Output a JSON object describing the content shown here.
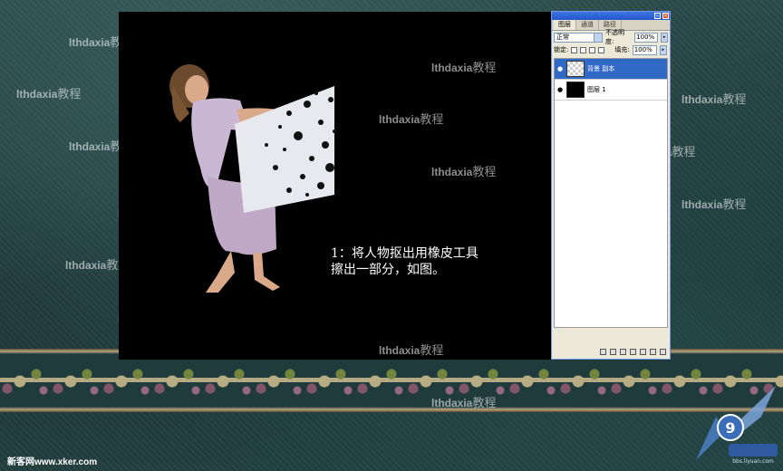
{
  "watermarks": [
    {
      "text": "lthdaxia",
      "cn": "教程"
    },
    {
      "text": "lthdaxia",
      "cn": "教程"
    },
    {
      "text": "lthdaxia",
      "cn": "教程"
    },
    {
      "text": "lthdaxia",
      "cn": "教程"
    },
    {
      "text": "lthdaxia",
      "cn": "教程"
    },
    {
      "text": "lthdaxia",
      "cn": "教程"
    },
    {
      "text": "lthdaxia",
      "cn": "教程"
    },
    {
      "text": "lthdaxia",
      "cn": "教程"
    },
    {
      "text": "lthdaxia",
      "cn": "教程"
    },
    {
      "text": "lthdaxia",
      "cn": "教程"
    },
    {
      "text": "lthdaxia",
      "cn": "教程"
    },
    {
      "text": "lthdaxia",
      "cn": "教程"
    },
    {
      "text": "lthdaxia",
      "cn": "教程"
    },
    {
      "text": "lthdaxia",
      "cn": "教程"
    }
  ],
  "caption": {
    "line1": "1：将人物抠出用橡皮工具",
    "line2": "擦出一部分，如图。"
  },
  "layers_panel": {
    "tabs": [
      "图层",
      "通道",
      "路径"
    ],
    "active_tab": "图层",
    "blend_mode": "正常",
    "opacity_label": "不透明度:",
    "opacity_value": "100%",
    "lock_label": "锁定:",
    "fill_label": "填充:",
    "fill_value": "100%",
    "layers": [
      {
        "name": "背景 副本",
        "selected": true,
        "thumb": "transparent"
      },
      {
        "name": "图层 1",
        "selected": false,
        "thumb": "black"
      }
    ]
  },
  "footer": {
    "site": "新客网www.xker.com",
    "logo_url": "bbs.liyuan.com"
  },
  "colors": {
    "canvas": "#000000",
    "panel_bg": "#ece9d8",
    "selection": "#3169c6",
    "titlebar": "#2656c9"
  }
}
